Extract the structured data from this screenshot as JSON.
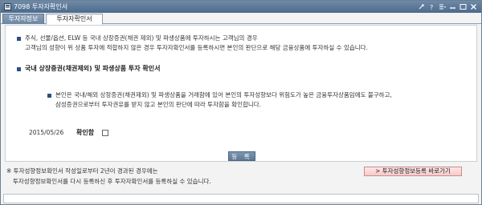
{
  "window": {
    "title": "7098 투자자확인서"
  },
  "tabs": [
    {
      "label": "투자자정보"
    },
    {
      "label": "투자자확인서"
    }
  ],
  "intro": {
    "line1": "주식, 선물/옵션, ELW 등 국내 상장증권(채권 제외) 및 파생상품에 투자하시는 고객님의 경우",
    "line2": "고객님의 성향이 위 상품 투자에 적합하지 않은 경우 투자자확인서를 등록하시면 본인의 판단으로 해당 금융상품에 투자하실 수 있습니다."
  },
  "section": {
    "heading": "국내 상장증권(채권제외) 및 파생상품 투자 확인서",
    "line1": "본인은 국내/해외 상장증권(채권제외) 및 파생상품을 거래함에 있어 본인의 투자성향보다 위험도가 높은 금융투자상품임에도 불구하고,",
    "line2": "삼성증권으로부터 투자권유를 받지 않고 본인의 판단에 따라 투자함을 확인합니다."
  },
  "confirm": {
    "date": "2015/05/26",
    "label": "확인함",
    "checked": false
  },
  "register_button": "등 록",
  "footer_note": {
    "line1": "※ 투자성향정보확인서 작성일로부터 2년이 경과된 경우에는",
    "line2": "투자성향정보확인서를 다시 등록하신 후 투자자확인서를 등록하실 수 있습니다."
  },
  "goto_button": "> 투자성향정보등록 바로가기",
  "colors": {
    "titlebar": "#5a779a",
    "bullet": "#2c4d85",
    "goto_button_bg": "#f7caca"
  }
}
